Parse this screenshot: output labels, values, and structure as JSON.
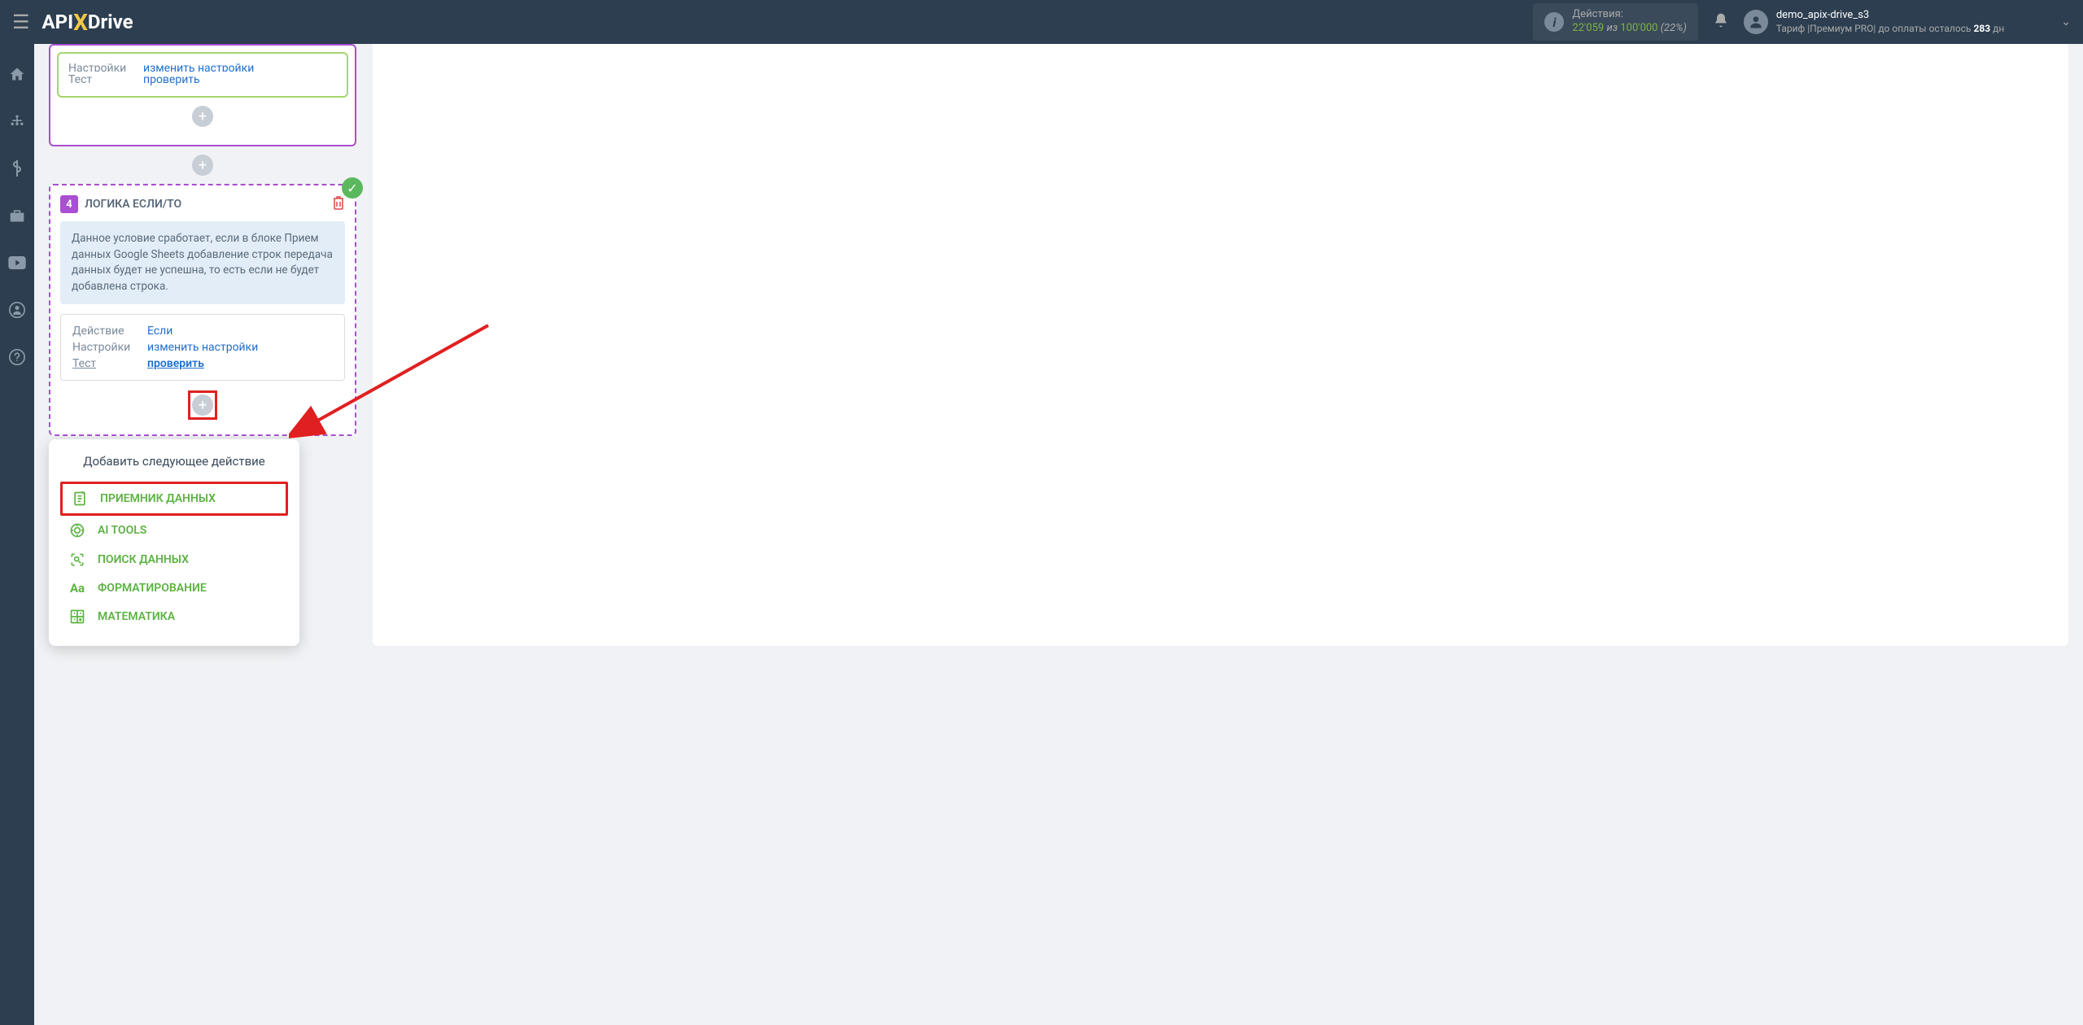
{
  "header": {
    "logo": {
      "api": "API",
      "x": "X",
      "drive": "Drive"
    },
    "actions": {
      "label": "Действия:",
      "used": "22'059",
      "of_word": "из",
      "total": "100'000",
      "percent": "(22%)"
    },
    "user": {
      "name": "demo_apix-drive_s3",
      "tariff_prefix": "Тариф |Премиум PRO| до оплаты осталось ",
      "days": "283",
      "days_suffix": " дн"
    }
  },
  "card1": {
    "row1_label": "Настройки",
    "row1_value": "изменить настройки",
    "row2_label": "Тест",
    "row2_value": "проверить"
  },
  "card4": {
    "step_num": "4",
    "title": "ЛОГИКА ЕСЛИ/ТО",
    "info": "Данное условие сработает, если в блоке Прием данных Google Sheets добавление строк передача данных будет не успешна, то есть если не будет добавлена строка.",
    "rows": {
      "action_label": "Действие",
      "action_value": "Если",
      "settings_label": "Настройки",
      "settings_value": "изменить настройки",
      "test_label": "Тест",
      "test_value": "проверить"
    }
  },
  "popup": {
    "title": "Добавить следующее действие",
    "items": {
      "data_receiver": "ПРИЕМНИК ДАННЫХ",
      "ai_tools": "AI TOOLS",
      "data_search": "ПОИСК ДАННЫХ",
      "formatting": "ФОРМАТИРОВАНИЕ",
      "math": "МАТЕМАТИКА"
    }
  }
}
